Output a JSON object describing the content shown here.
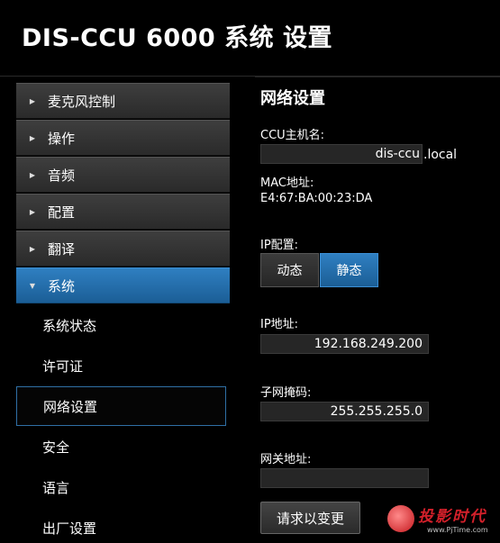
{
  "app": {
    "title": "DIS-CCU 6000 系统 设置"
  },
  "sidebar": {
    "items": [
      {
        "label": "麦克风控制",
        "expanded": false
      },
      {
        "label": "操作",
        "expanded": false
      },
      {
        "label": "音频",
        "expanded": false
      },
      {
        "label": "配置",
        "expanded": false
      },
      {
        "label": "翻译",
        "expanded": false
      },
      {
        "label": "系统",
        "expanded": true
      }
    ],
    "submenu": [
      {
        "label": "系统状态"
      },
      {
        "label": "许可证"
      },
      {
        "label": "网络设置",
        "selected": true
      },
      {
        "label": "安全"
      },
      {
        "label": "语言"
      },
      {
        "label": "出厂设置"
      }
    ]
  },
  "network": {
    "title": "网络设置",
    "hostname_label": "CCU主机名:",
    "hostname_value": "dis-ccu",
    "hostname_suffix": ".local",
    "mac_label": "MAC地址:",
    "mac_value": "E4:67:BA:00:23:DA",
    "ip_config_label": "IP配置:",
    "ip_config_dynamic": "动态",
    "ip_config_static": "静态",
    "ip_config_selected": "静态",
    "ip_label": "IP地址:",
    "ip_value": "192.168.249.200",
    "subnet_label": "子网掩码:",
    "subnet_value": "255.255.255.0",
    "gateway_label": "网关地址:",
    "gateway_value": "",
    "submit_label": "请求以变更"
  },
  "watermark": {
    "text": "投影时代",
    "url": "www.PjTime.com"
  },
  "colors": {
    "accent": "#2f7fc1",
    "background": "#000000",
    "watermark": "#d3202a"
  }
}
